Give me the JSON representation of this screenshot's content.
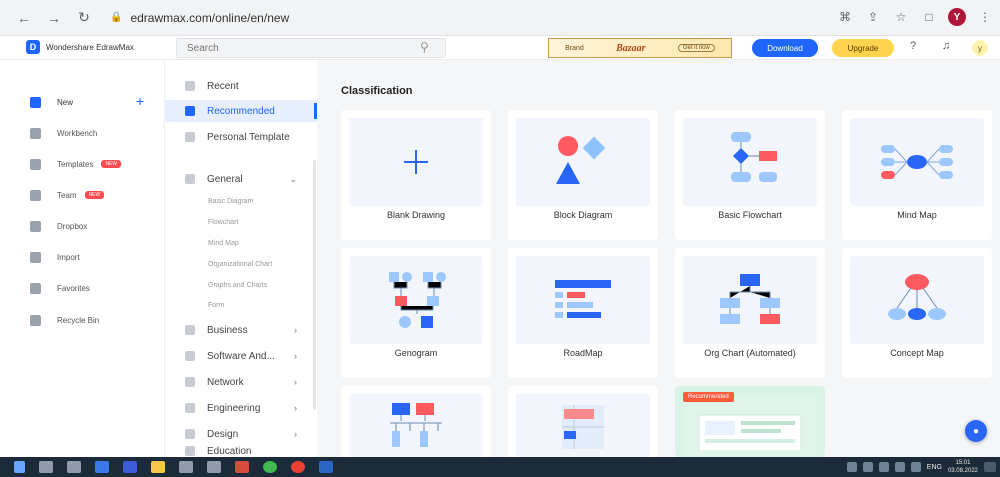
{
  "browser": {
    "url": "edrawmax.com/online/en/new",
    "lang": "ENG"
  },
  "app": {
    "brand": "Wondershare EdrawMax",
    "search_placeholder": "Search",
    "banner": {
      "left_text": "Brand",
      "logo_text": "Bazaar",
      "pill_text": "Get it now"
    },
    "download_label": "Download",
    "upgrade_label": "Upgrade",
    "avatar_letter": "y",
    "accent": "#1f66ff"
  },
  "sidebar": {
    "items": [
      {
        "label": "New",
        "icon": "plus-square-icon"
      },
      {
        "label": "Workbench",
        "icon": "cloud-icon"
      },
      {
        "label": "Templates",
        "icon": "template-icon",
        "tag": "NEW"
      },
      {
        "label": "Team",
        "icon": "team-icon",
        "tag": "NEW"
      },
      {
        "label": "Dropbox",
        "icon": "dropbox-icon"
      },
      {
        "label": "Import",
        "icon": "import-icon"
      },
      {
        "label": "Favorites",
        "icon": "heart-icon"
      },
      {
        "label": "Recycle Bin",
        "icon": "trash-icon"
      }
    ]
  },
  "categories": {
    "top": [
      {
        "label": "Recent"
      },
      {
        "label": "Recommended"
      },
      {
        "label": "Personal Template"
      }
    ],
    "general": {
      "label": "General",
      "children": [
        "Basic Diagram",
        "Flowchart",
        "Mind Map",
        "Organizational Chart",
        "Graphs and Charts",
        "Form"
      ]
    },
    "others": [
      {
        "label": "Business"
      },
      {
        "label": "Software And..."
      },
      {
        "label": "Network"
      },
      {
        "label": "Engineering"
      },
      {
        "label": "Design"
      },
      {
        "label": "Education"
      }
    ]
  },
  "main": {
    "section_title": "Classification",
    "cards": [
      {
        "label": "Blank Drawing"
      },
      {
        "label": "Block Diagram"
      },
      {
        "label": "Basic Flowchart"
      },
      {
        "label": "Mind Map"
      },
      {
        "label": "Genogram"
      },
      {
        "label": "RoadMap"
      },
      {
        "label": "Org Chart (Automated)"
      },
      {
        "label": "Concept Map"
      },
      {
        "label": ""
      },
      {
        "label": ""
      },
      {
        "label": "",
        "badge": "Recommended"
      }
    ]
  },
  "taskbar": {
    "time": "15:01",
    "date": "03.08.2022"
  }
}
